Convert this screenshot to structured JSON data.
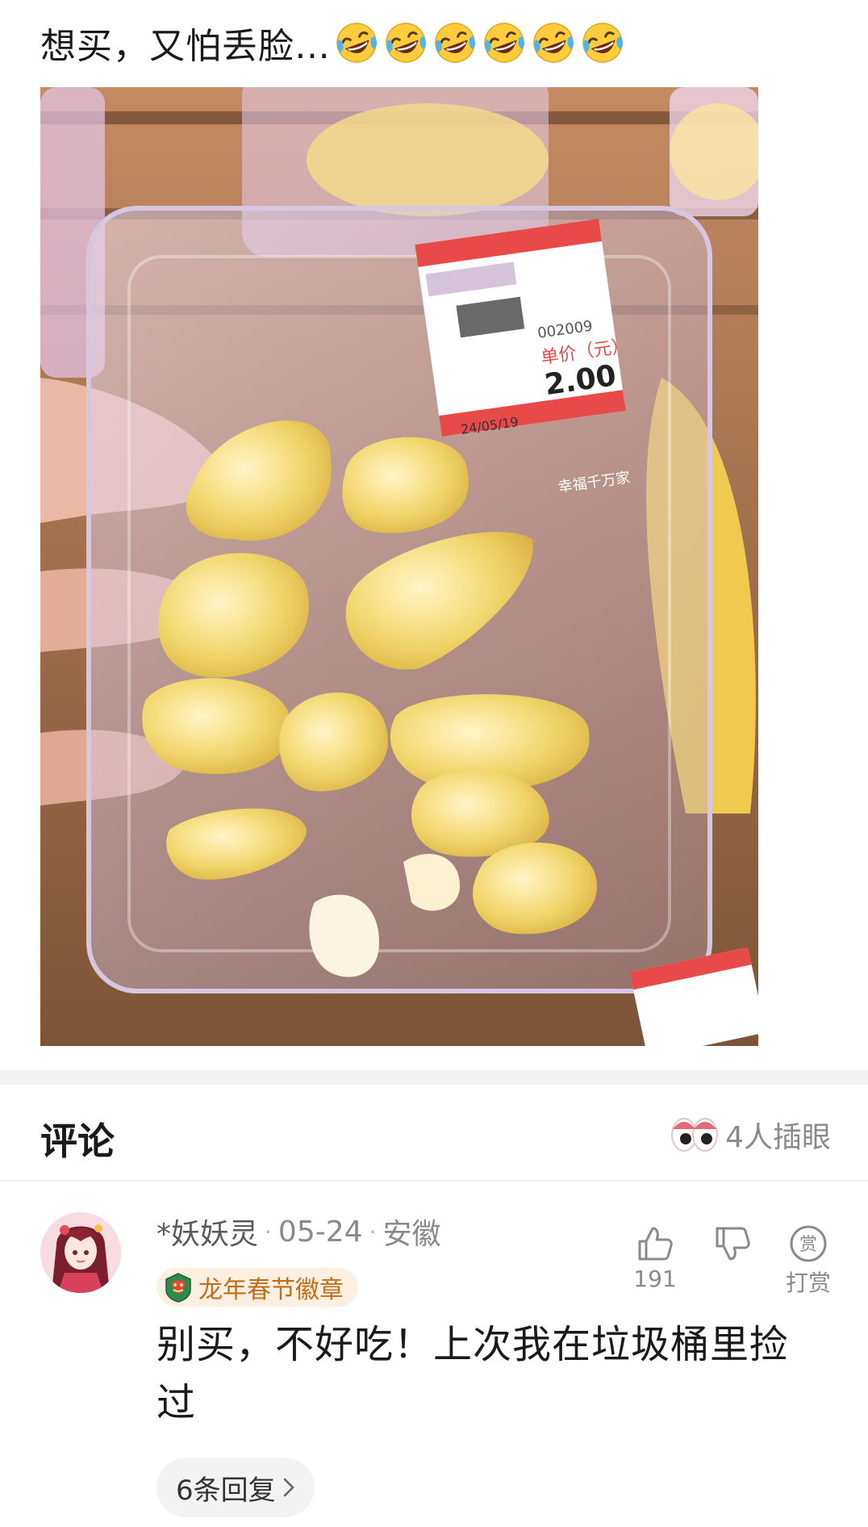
{
  "post": {
    "title": "想买，又怕丢脸…",
    "emoji_count": 6,
    "emoji_icon": "rolling-on-floor-laughing-emoji",
    "price_tag": {
      "unit_price_label": "单价（元）",
      "price": "2.00",
      "pack_date": "24/05/19",
      "code": "002009",
      "store": "幸福千万家"
    }
  },
  "comments": {
    "title": "评论",
    "peek_text": "4人插眼",
    "items": [
      {
        "username": "*妖妖灵",
        "date": "05-24",
        "location": "安徽",
        "badge": "龙年春节徽章",
        "text": "别买，不好吃！上次我在垃圾桶里捡过",
        "likes": "191",
        "reward_label": "打赏",
        "reward_icon_char": "赏",
        "replies_label": "6条回复"
      }
    ]
  },
  "colors": {
    "accent_badge": "#c06e1c",
    "muted": "#8a8a8a"
  }
}
